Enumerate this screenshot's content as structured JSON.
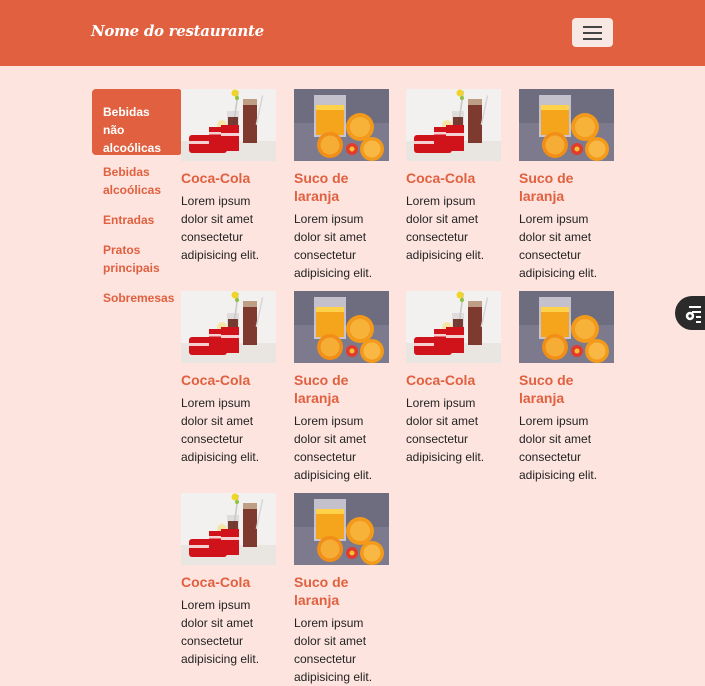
{
  "navbar": {
    "brand": "Nome do restaurante",
    "toggler_icon": "hamburger-menu-icon"
  },
  "sidebar": {
    "items": [
      {
        "label": "Bebidas não alcoólicas",
        "active": true
      },
      {
        "label": "Bebidas alcoólicas",
        "active": false
      },
      {
        "label": "Entradas",
        "active": false
      },
      {
        "label": "Pratos principais",
        "active": false
      },
      {
        "label": "Sobremesas",
        "active": false
      }
    ]
  },
  "products": [
    {
      "title": "Coca-Cola",
      "desc": "Lorem ipsum dolor sit amet consectetur adipisicing elit.",
      "image": "coca-cola-image"
    },
    {
      "title": "Suco de laranja",
      "desc": "Lorem ipsum dolor sit amet consectetur adipisicing elit.",
      "image": "orange-juice-image"
    },
    {
      "title": "Coca-Cola",
      "desc": "Lorem ipsum dolor sit amet consectetur adipisicing elit.",
      "image": "coca-cola-image"
    },
    {
      "title": "Suco de laranja",
      "desc": "Lorem ipsum dolor sit amet consectetur adipisicing elit.",
      "image": "orange-juice-image"
    },
    {
      "title": "Coca-Cola",
      "desc": "Lorem ipsum dolor sit amet consectetur adipisicing elit.",
      "image": "coca-cola-image"
    },
    {
      "title": "Suco de laranja",
      "desc": "Lorem ipsum dolor sit amet consectetur adipisicing elit.",
      "image": "orange-juice-image"
    },
    {
      "title": "Coca-Cola",
      "desc": "Lorem ipsum dolor sit amet consectetur adipisicing elit.",
      "image": "coca-cola-image"
    },
    {
      "title": "Suco de laranja",
      "desc": "Lorem ipsum dolor sit amet consectetur adipisicing elit.",
      "image": "orange-juice-image"
    },
    {
      "title": "Coca-Cola",
      "desc": "Lorem ipsum dolor sit amet consectetur adipisicing elit.",
      "image": "coca-cola-image"
    },
    {
      "title": "Suco de laranja",
      "desc": "Lorem ipsum dolor sit amet consectetur adipisicing elit.",
      "image": "orange-juice-image"
    }
  ],
  "floating_button": {
    "icon": "list-settings-icon"
  },
  "colors": {
    "primary": "#e0603f",
    "background": "#fde4df"
  }
}
